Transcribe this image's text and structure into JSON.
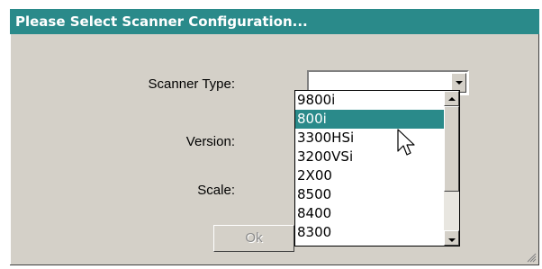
{
  "window": {
    "title": "Please Select Scanner Configuration...",
    "accent_color": "#2a8a8a"
  },
  "form": {
    "scanner_type_label": "Scanner Type:",
    "version_label": "Version:",
    "scale_label": "Scale:",
    "scanner_type_value": ""
  },
  "dropdown": {
    "items": [
      "9800i",
      "800i",
      "3300HSi",
      "3200VSi",
      "2X00",
      "8500",
      "8400",
      "8300"
    ],
    "selected": "800i"
  },
  "buttons": {
    "ok_label": "Ok"
  },
  "icons": {
    "combo_arrow": "chevron-down-icon",
    "scroll_up": "scroll-up-icon",
    "scroll_down": "scroll-down-icon",
    "cursor": "mouse-pointer-icon",
    "resize": "resize-grip-icon"
  }
}
